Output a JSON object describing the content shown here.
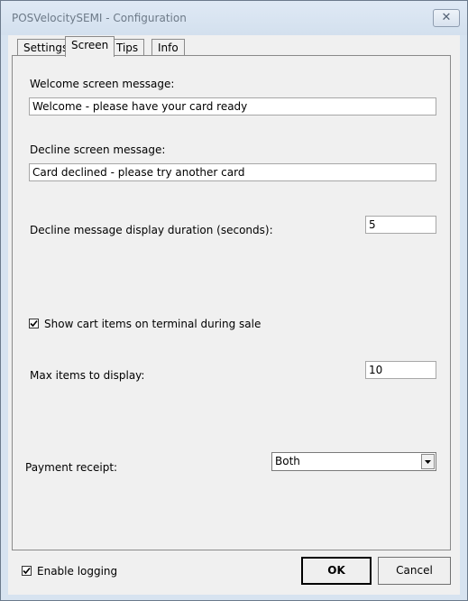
{
  "window": {
    "title": "POSVelocitySEMI - Configuration",
    "close_glyph": "✕"
  },
  "tabs": [
    {
      "label": "Settings",
      "active": false
    },
    {
      "label": "Screen",
      "active": true
    },
    {
      "label": "Tips",
      "active": false
    },
    {
      "label": "Info",
      "active": false
    }
  ],
  "screen": {
    "welcome_label": "Welcome screen message:",
    "welcome_value": "Welcome - please have your card ready",
    "decline_label": "Decline screen message:",
    "decline_value": "Card declined - please try another card",
    "duration_label": "Decline message display duration (seconds):",
    "duration_value": "5",
    "show_cart_label": "Show cart items on terminal during sale",
    "show_cart_checked": true,
    "max_items_label": "Max items to display:",
    "max_items_value": "10",
    "receipt_label": "Payment receipt:",
    "receipt_value": "Both"
  },
  "footer": {
    "logging_label": "Enable logging",
    "logging_checked": true,
    "ok_label": "OK",
    "cancel_label": "Cancel"
  },
  "icons": {
    "close": "close-icon",
    "check": "checkmark-icon",
    "dropdown": "chevron-down-icon"
  }
}
